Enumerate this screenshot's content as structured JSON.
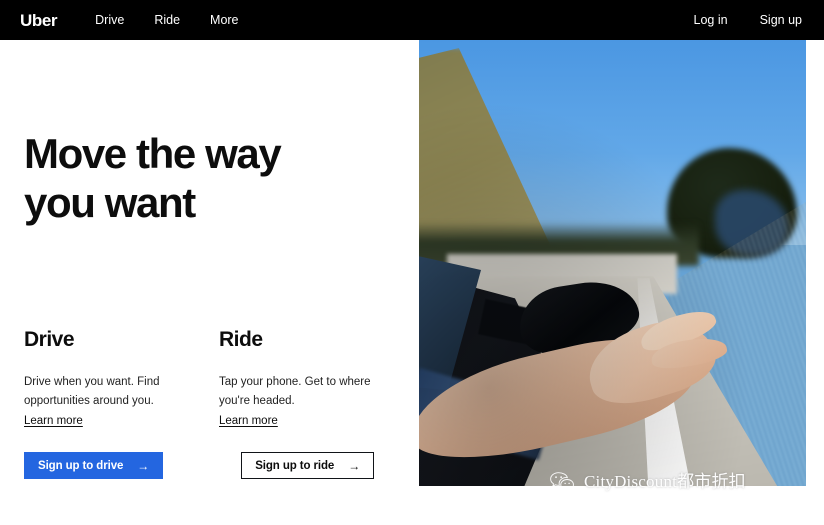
{
  "header": {
    "logo": "Uber",
    "nav_left": [
      {
        "label": "Drive",
        "name": "nav-drive"
      },
      {
        "label": "Ride",
        "name": "nav-ride"
      },
      {
        "label": "More",
        "name": "nav-more"
      }
    ],
    "nav_right": [
      {
        "label": "Log in",
        "name": "nav-login"
      },
      {
        "label": "Sign up",
        "name": "nav-signup"
      }
    ],
    "background": "#000000",
    "text_color": "#ffffff"
  },
  "hero": {
    "headline": "Move the way\nyou want",
    "photo_alt": "Person's hand reaching out of a moving car window on a coastal road"
  },
  "cards": [
    {
      "title": "Drive",
      "body": "Drive when you want. Find opportunities around you.",
      "link": "Learn more"
    },
    {
      "title": "Ride",
      "body": "Tap your phone. Get to where you're headed.",
      "link": "Learn more"
    }
  ],
  "cta": [
    {
      "label": "Sign up to drive",
      "arrow": "→",
      "style": "primary"
    },
    {
      "label": "Sign up to ride",
      "arrow": "→",
      "style": "outline"
    }
  ],
  "watermark": {
    "text": "CityDiscount都市折扣",
    "icon": "wechat-icon"
  },
  "colors": {
    "brand_blue": "#2466e0",
    "header_black": "#000000",
    "text_dark": "#0d0d0d",
    "page_background": "#ffffff"
  }
}
